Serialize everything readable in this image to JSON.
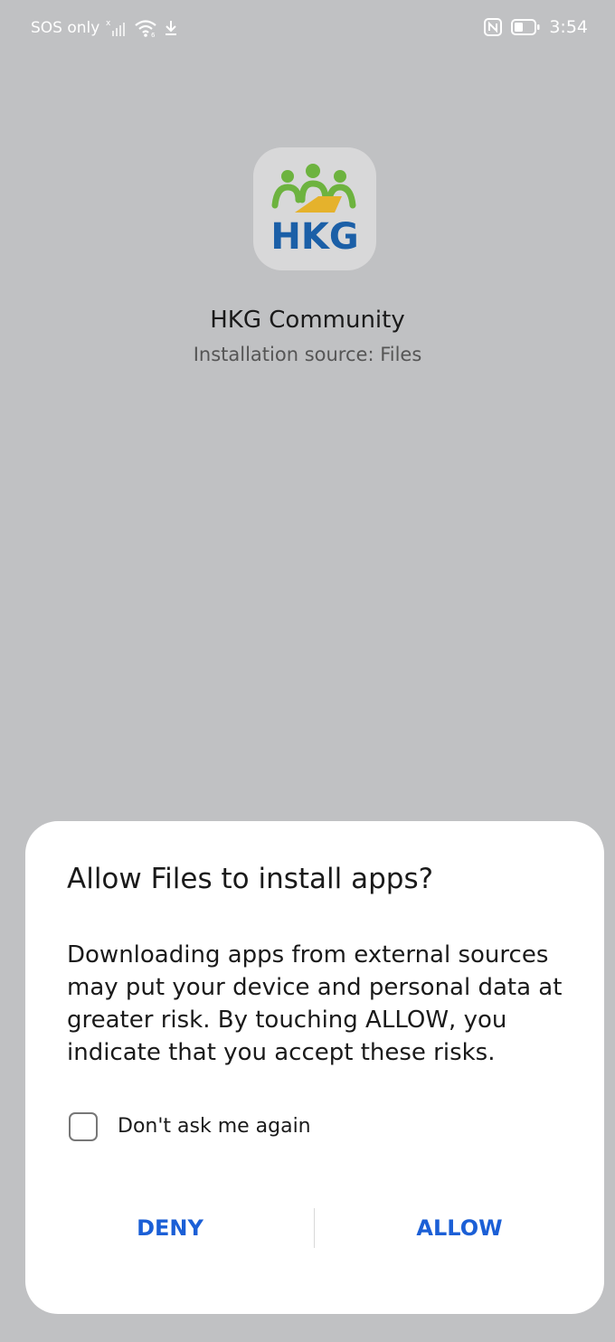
{
  "status_bar": {
    "carrier_text": "SOS only",
    "time": "3:54",
    "icons": [
      "no-signal-icon",
      "wifi-icon",
      "download-icon",
      "nfc-icon",
      "battery-icon"
    ]
  },
  "app": {
    "name": "HKG Community",
    "source": "Installation source: Files",
    "icon_text": "HKG",
    "icon_colors": {
      "green": "#6db33f",
      "blue": "#1b5fa7",
      "yellow": "#e5b22c"
    }
  },
  "dialog": {
    "title": "Allow Files to install apps?",
    "body": "Downloading apps from external sources may put your device and personal data at greater risk. By touching ALLOW, you indicate that you accept these risks.",
    "checkbox_label": "Don't ask me again",
    "checkbox_checked": false,
    "deny_label": "DENY",
    "allow_label": "ALLOW"
  },
  "colors": {
    "background": "#c0c1c3",
    "button_accent": "#1b5fd6"
  }
}
